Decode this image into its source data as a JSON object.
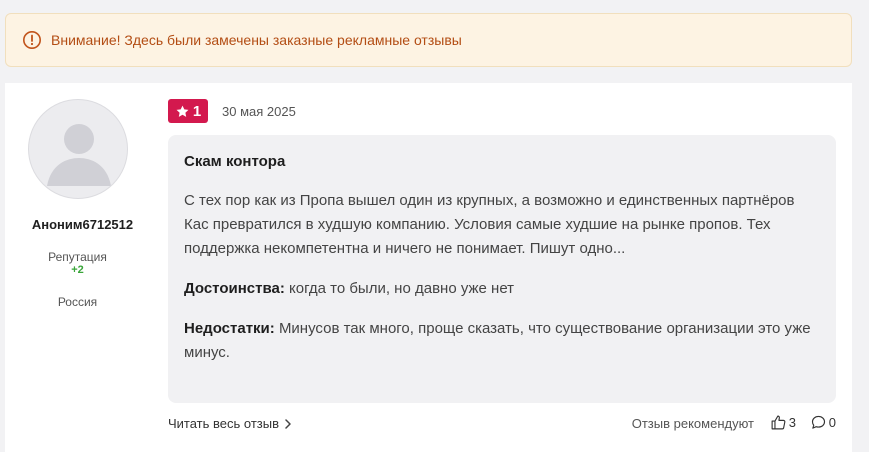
{
  "warning": {
    "icon": "exclamation-circle-icon",
    "text": "Внимание! Здесь были замечены заказные рекламные отзывы",
    "color": "#b34d14"
  },
  "review": {
    "user": {
      "avatar_icon": "default-avatar-icon",
      "name": "Аноним6712512",
      "reputation_label": "Репутация",
      "reputation_value": "+2",
      "country": "Россия"
    },
    "rating": {
      "value": "1",
      "icon": "star-icon",
      "color": "#d3194e"
    },
    "date": "30 мая 2025",
    "title": "Скам контора",
    "text": "С тех пор как из Пропа вышел один из крупных, а возможно и единственных партнёров Кас превратился в худшую компанию. Условия самые худшие на рынке пропов. Тех поддержка некомпетентна и ничего не понимает. Пишут одно...",
    "pros_label": "Достоинства:",
    "pros": "когда то были, но давно уже нет",
    "cons_label": "Недостатки:",
    "cons": "Минусов так много, проще сказать, что существование организации это уже минус.",
    "read_more": "Читать весь отзыв",
    "recommend_label": "Отзыв рекомендуют",
    "likes": "3",
    "comments": "0"
  }
}
